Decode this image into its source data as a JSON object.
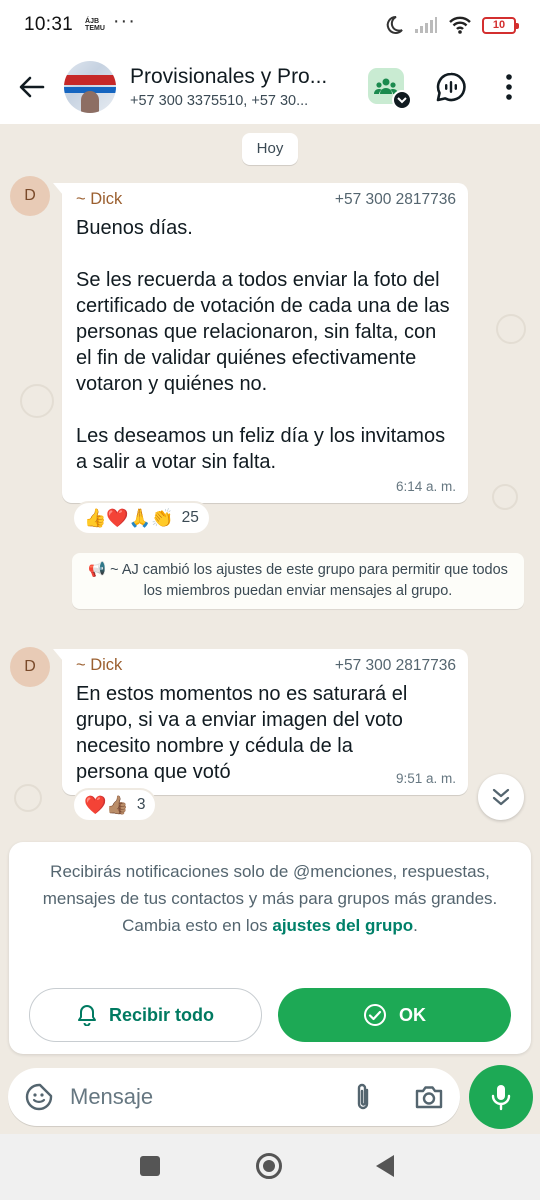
{
  "status_bar": {
    "time": "10:31",
    "temu_line1": "ÁJB",
    "temu_line2": "TEMU",
    "more": "···",
    "battery": "10"
  },
  "header": {
    "title": "Provisionales y Pro...",
    "subtitle": "+57 300 3375510, +57 30..."
  },
  "chat": {
    "date_chip": "Hoy",
    "messages": [
      {
        "avatar_initial": "D",
        "sender": "~ Dick",
        "phone": "+57 300 2817736",
        "text": "Buenos días.\n\nSe les recuerda a todos enviar la foto del certificado de votación de cada una de las personas que relacionaron, sin falta, con el fin de validar quiénes efectivamente votaron y quiénes no.\n\nLes deseamos un feliz día y los invitamos a salir a votar sin falta.",
        "time": "6:14 a. m.",
        "reactions": "👍❤️🙏👏",
        "reaction_count": "25"
      },
      {
        "avatar_initial": "D",
        "sender": "~ Dick",
        "phone": "+57 300 2817736",
        "text": "En estos momentos no es saturará el grupo, si va a enviar imagen del voto necesito nombre y cédula de la persona que votó",
        "time": "9:51 a. m.",
        "reactions": "❤️👍🏽",
        "reaction_count": "3"
      }
    ],
    "system_message": "📢 ~ AJ cambió los ajustes de este grupo para permitir que todos los miembros puedan enviar mensajes al grupo."
  },
  "notice": {
    "text_before": "Recibirás notificaciones solo de @menciones, respuestas, mensajes de tus contactos y más para grupos más grandes. Cambia esto en los ",
    "link": "ajustes del grupo",
    "text_after": ".",
    "receive_all_label": "Recibir todo",
    "ok_label": "OK"
  },
  "composer": {
    "placeholder": "Mensaje"
  },
  "colors": {
    "accent_green": "#1da955",
    "link_green": "#008069",
    "chat_background": "#efeae2",
    "sender_name": "#9b5f2f"
  }
}
